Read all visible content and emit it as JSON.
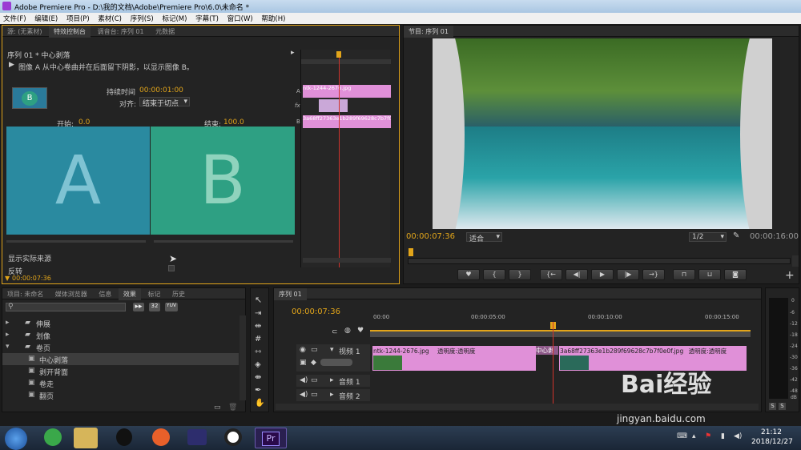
{
  "window": {
    "title": "Adobe Premiere Pro - D:\\我的文档\\Adobe\\Premiere Pro\\6.0\\未命名 *"
  },
  "menu": [
    "文件(F)",
    "编辑(E)",
    "项目(P)",
    "素材(C)",
    "序列(S)",
    "标记(M)",
    "字幕(T)",
    "窗口(W)",
    "帮助(H)"
  ],
  "effect_controls": {
    "tabs": [
      "源: (无素材)",
      "特效控制台",
      "调音台: 序列 01",
      "元数据"
    ],
    "sequence_label": "序列 01 * 中心剥落",
    "description": "图像 A 从中心卷曲并在后面留下阴影，以显示图像 B。",
    "duration_label": "持续时间",
    "duration_value": "00:00:01:00",
    "align_label": "对齐:",
    "align_value": "结束于切点",
    "start_label": "开始:",
    "start_value": "0.0",
    "end_label": "结束:",
    "end_value": "100.0",
    "preview_a": "A",
    "preview_b": "B",
    "show_actual_sources": "显示实际来源",
    "reverse": "反转",
    "timecode": "00:00:07:36",
    "mini_clip_a": "ntk-1244-2676.jpg",
    "mini_clip_b": "3a68ff27363e1b289f69628c7b7f0e0f.jpg",
    "row_labels": [
      "A",
      "fx",
      "B"
    ]
  },
  "program": {
    "tab": "节目: 序列 01",
    "timecode_left": "00:00:07:36",
    "fit": "适合",
    "ratio": "1/2",
    "timecode_right": "00:00:16:00"
  },
  "transport_buttons": [
    "marker",
    "in",
    "out",
    "go-in",
    "step-back",
    "play",
    "step-forward",
    "go-out",
    "lift",
    "extract",
    "export-frame"
  ],
  "project": {
    "tabs": [
      "项目: 未命名",
      "媒体浏览器",
      "信息",
      "效果",
      "标记",
      "历史"
    ],
    "toolbar": [
      "32",
      "YUV"
    ],
    "tree": [
      {
        "label": "伸展",
        "type": "folder"
      },
      {
        "label": "划像",
        "type": "folder"
      },
      {
        "label": "卷页",
        "type": "folder-open"
      },
      {
        "label": "中心剥落",
        "type": "item",
        "selected": true
      },
      {
        "label": "剥开背面",
        "type": "item"
      },
      {
        "label": "卷走",
        "type": "item"
      },
      {
        "label": "翻页",
        "type": "item"
      }
    ]
  },
  "timeline": {
    "tab": "序列 01",
    "timecode": "00:00:07:36",
    "ruler": [
      "00:00",
      "00:00:05:00",
      "00:00:10:00",
      "00:00:15:00"
    ],
    "video_track": "视频 1",
    "audio_tracks": [
      "音频 1",
      "音频 2"
    ],
    "clips": [
      {
        "name": "ntk-1244-2676.jpg",
        "fx": "透明度:透明度"
      },
      {
        "name": "中心剥",
        "fx": ""
      },
      {
        "name": "3a68ff27363e1b289f69628c7b7f0e0f.jpg",
        "fx": "透明度:透明度"
      }
    ]
  },
  "audio_meter": {
    "labels": [
      "0",
      "-6",
      "-12",
      "-18",
      "-24",
      "-30",
      "-36",
      "-42",
      "-48",
      "dB"
    ],
    "buttons": [
      "S",
      "S"
    ]
  },
  "watermark": {
    "logo": "Bai经验",
    "url": "jingyan.baidu.com"
  },
  "taskbar": {
    "time": "21:12",
    "date": "2018/12/27",
    "pr_label": "Pr"
  },
  "colors": {
    "accent": "#e2a51a",
    "playhead": "#d0342c",
    "clip": "#e090d8",
    "teal": "#2a8aa0",
    "green": "#2ea083"
  }
}
